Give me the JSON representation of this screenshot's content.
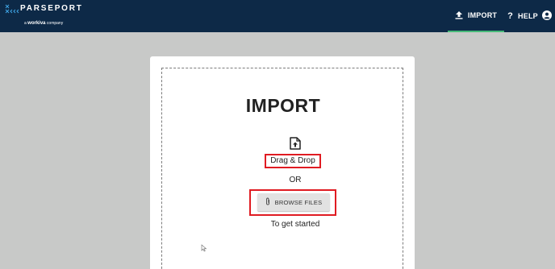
{
  "brand": {
    "mark": "><><<<<<<<<",
    "name": "PARSEPORT",
    "tagline_prefix": "a",
    "tagline_brand": "workiva",
    "tagline_suffix": "company"
  },
  "nav": {
    "import_label": "IMPORT",
    "help_label": "HELP",
    "import_icon": "upload-icon",
    "help_icon": "question-icon",
    "user_icon": "user-icon"
  },
  "main": {
    "title": "IMPORT",
    "drag_drop": "Drag & Drop",
    "or": "OR",
    "browse_label": "BROWSE FILES",
    "get_started": "To get started"
  },
  "colors": {
    "topbar": "#0d2947",
    "accent_underline": "#46b978",
    "highlight": "#e01b22",
    "background": "#c8c9c8"
  }
}
